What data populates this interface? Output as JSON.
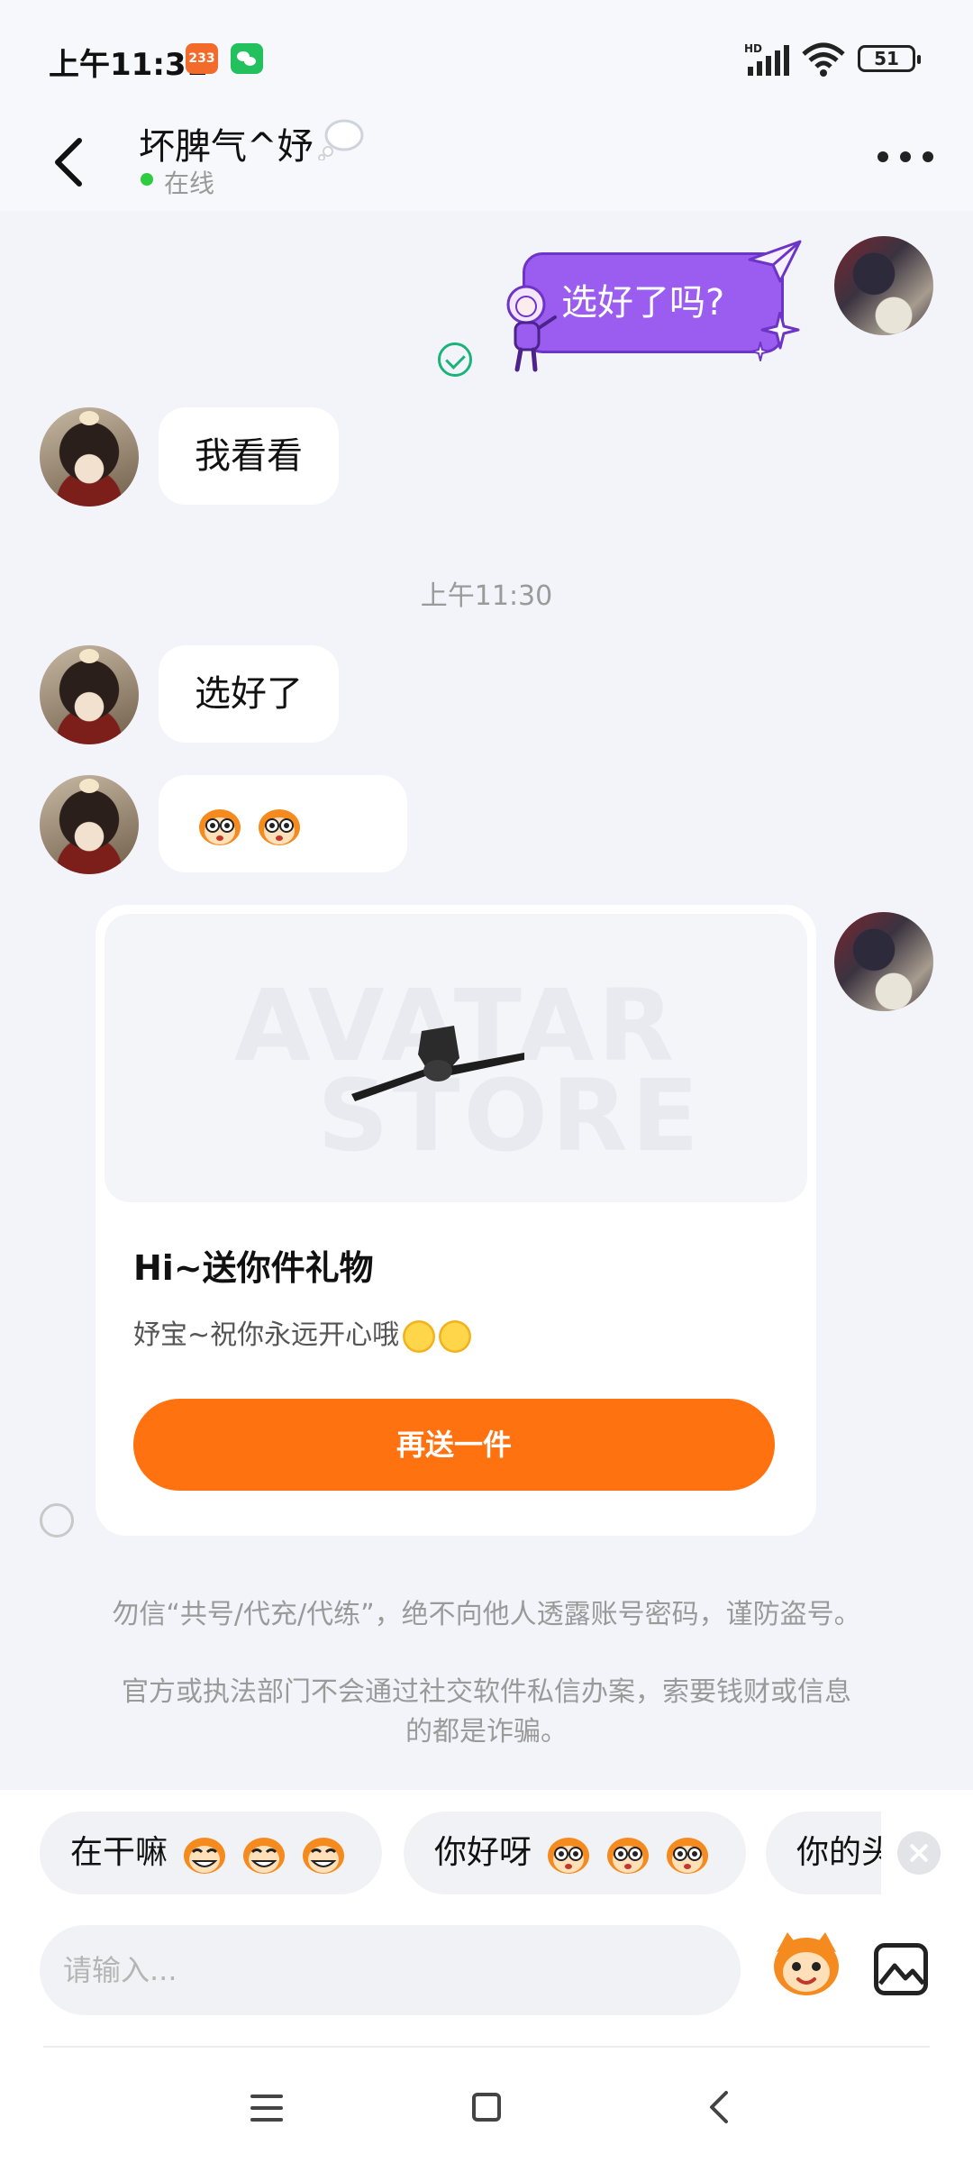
{
  "status_bar": {
    "time": "上午11:31",
    "app_badge": "233",
    "network": "HD",
    "battery": "51"
  },
  "header": {
    "contact_name": "坏脾气^妤",
    "status": "在线"
  },
  "messages": {
    "m1_text": "选好了吗?",
    "m2_text": "我看看",
    "timestamp": "上午11:30",
    "m3_text": "选好了"
  },
  "gift_card": {
    "watermark_line1": "AVATAR",
    "watermark_line2": "STORE",
    "title": "Hi~送你件礼物",
    "message": "妤宝~祝你永远开心哦",
    "button_label": "再送一件"
  },
  "notices": {
    "line1": "勿信“共号/代充/代练”，绝不向他人透露账号密码，谨防盗号。",
    "line2a": "官方或执法部门不会通过社交软件私信办案，索要钱财或信息",
    "line2b": "的都是诈骗。"
  },
  "quick_replies": [
    {
      "label": "在干嘛"
    },
    {
      "label": "你好呀"
    },
    {
      "label": "你的头"
    }
  ],
  "input": {
    "placeholder": "请输入..."
  },
  "colors": {
    "accent": "#ff720f",
    "purple_bubble": "#9b5cf0",
    "online": "#2ecc40",
    "page_bg": "#f3f4f9"
  }
}
